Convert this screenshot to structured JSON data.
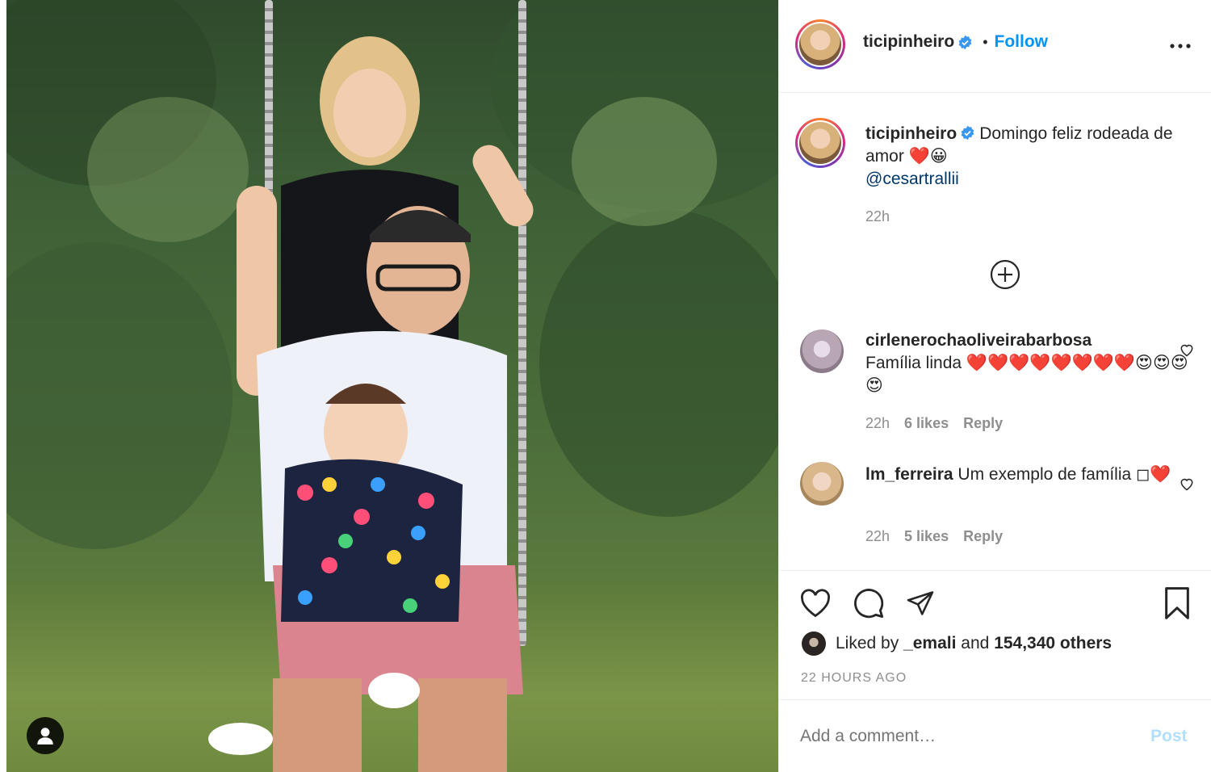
{
  "post": {
    "username": "ticipinheiro",
    "follow_label": "Follow",
    "separator": "•",
    "more_icon": "more-options-icon"
  },
  "caption": {
    "username": "ticipinheiro",
    "text": "Domingo feliz rodeada de amor ❤️😀",
    "mention": "@cesartrallii",
    "time": "22h"
  },
  "comments": [
    {
      "username": "cirlenerochaoliveirabarbosa",
      "text": "Família linda ❤️❤️❤️❤️❤️❤️❤️❤️😍😍😍😍",
      "time": "22h",
      "likes": "6 likes",
      "reply": "Reply"
    },
    {
      "username": "lm_ferreira",
      "text": "Um exemplo de família ◻❤️",
      "time": "22h",
      "likes": "5 likes",
      "reply": "Reply"
    }
  ],
  "likes": {
    "prefix": "Liked by",
    "user": "_emali",
    "and": "and",
    "count": "154,340 others"
  },
  "timestamp": "22 HOURS AGO",
  "comment_input": {
    "placeholder": "Add a comment…",
    "post_label": "Post"
  },
  "colors": {
    "accent": "#0095f6",
    "mention": "#00376b",
    "muted": "#8e8e8e",
    "post_disabled": "#b2dffc"
  }
}
